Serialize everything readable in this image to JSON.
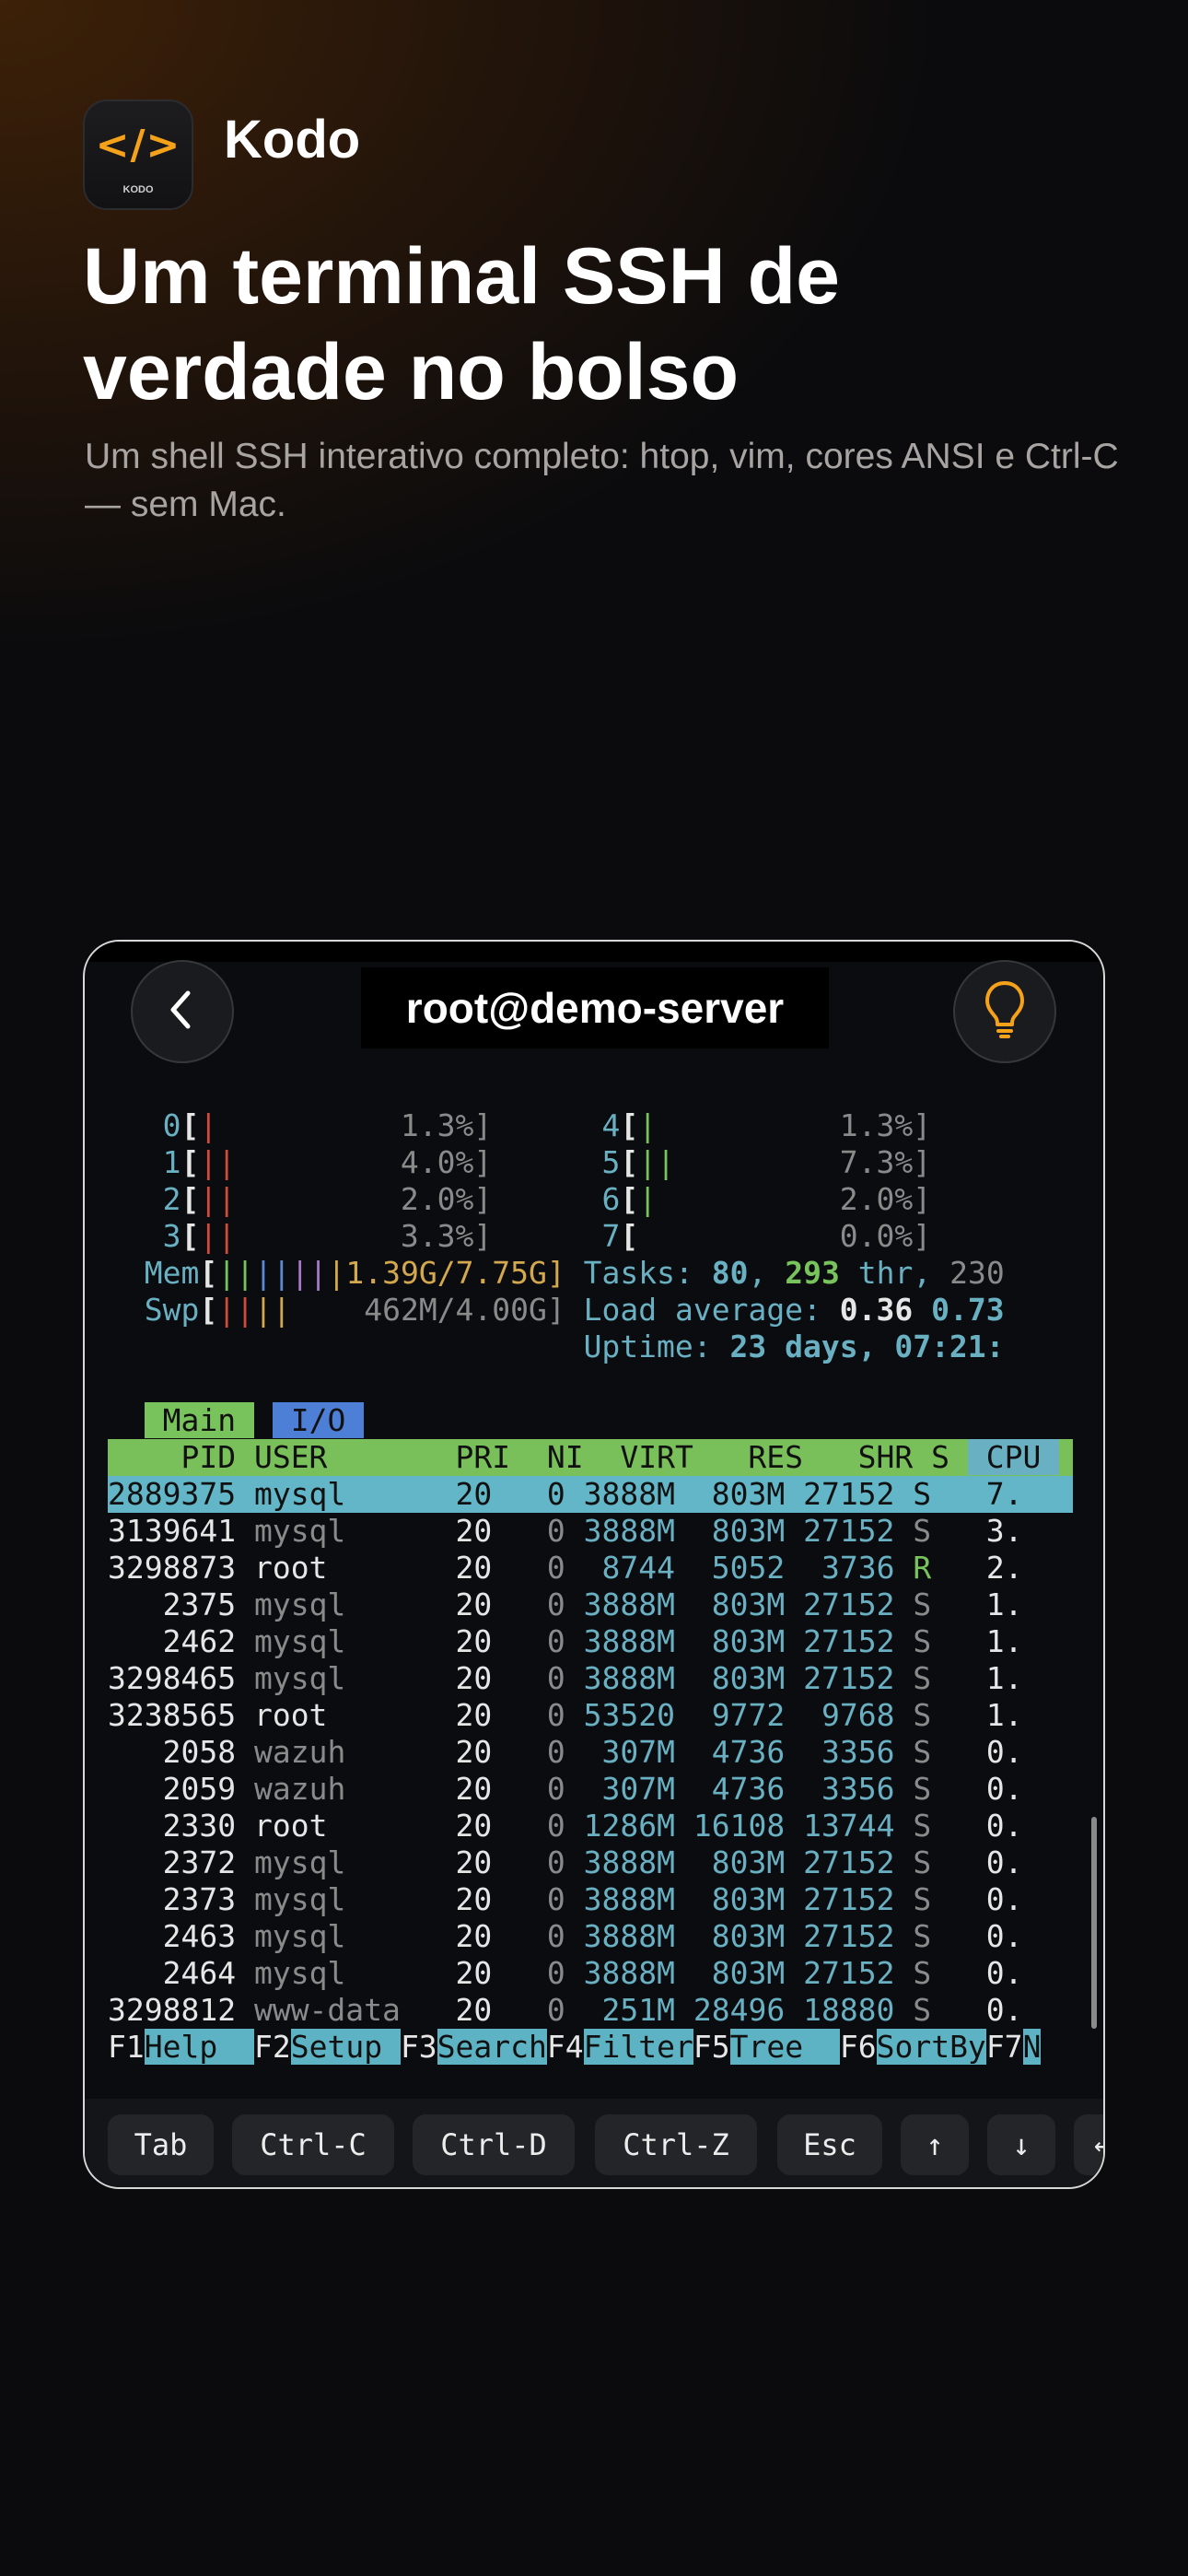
{
  "app": {
    "icon_glyph": "</>",
    "icon_wordmark": "KODO",
    "name": "Kodo"
  },
  "headline": "Um terminal SSH de verdade no bolso",
  "subtitle": "Um shell SSH interativo completo: htop, vim, cores ANSI e Ctrl-C — sem Mac.",
  "session": {
    "title": "root@demo-server",
    "back_icon": "chevron-left-icon",
    "hint_icon": "lightbulb-icon"
  },
  "htop": {
    "cpus": [
      {
        "id": "0",
        "bars": "|",
        "pct": "1.3%]"
      },
      {
        "id": "1",
        "bars": "||",
        "pct": "4.0%]"
      },
      {
        "id": "2",
        "bars": "||",
        "pct": "2.0%]"
      },
      {
        "id": "3",
        "bars": "||",
        "pct": "3.3%]"
      },
      {
        "id": "4",
        "bars": "|",
        "pct": "1.3%]"
      },
      {
        "id": "5",
        "bars": "||",
        "pct": "7.3%]"
      },
      {
        "id": "6",
        "bars": "|",
        "pct": "2.0%]"
      },
      {
        "id": "7",
        "bars": "",
        "pct": "0.0%]"
      }
    ],
    "mem": {
      "label": "Mem",
      "value": "1.39G/7.75G]"
    },
    "swp": {
      "label": "Swp",
      "value": "462M/4.00G]"
    },
    "tasks": {
      "label": "Tasks:",
      "count": "80",
      "sep": ",",
      "thr": "293",
      "thr_label": "thr,",
      "running": "230"
    },
    "load": {
      "label": "Load average:",
      "v1": "0.36",
      "v2": "0.73"
    },
    "uptime": {
      "label": "Uptime:",
      "value": "23 days, 07:21:"
    },
    "tabs": [
      "Main",
      "I/O"
    ],
    "columns": [
      "PID",
      "USER",
      "PRI",
      "NI",
      "VIRT",
      "RES",
      "SHR",
      "S",
      "CPU"
    ],
    "processes": [
      {
        "pid": "2889375",
        "user": "mysql",
        "pri": "20",
        "ni": "0",
        "virt": "3888M",
        "res": "803M",
        "shr": "27152",
        "s": "S",
        "cpu": "7."
      },
      {
        "pid": "3139641",
        "user": "mysql",
        "pri": "20",
        "ni": "0",
        "virt": "3888M",
        "res": "803M",
        "shr": "27152",
        "s": "S",
        "cpu": "3."
      },
      {
        "pid": "3298873",
        "user": "root",
        "pri": "20",
        "ni": "0",
        "virt": "8744",
        "res": "5052",
        "shr": "3736",
        "s": "R",
        "cpu": "2."
      },
      {
        "pid": "2375",
        "user": "mysql",
        "pri": "20",
        "ni": "0",
        "virt": "3888M",
        "res": "803M",
        "shr": "27152",
        "s": "S",
        "cpu": "1."
      },
      {
        "pid": "2462",
        "user": "mysql",
        "pri": "20",
        "ni": "0",
        "virt": "3888M",
        "res": "803M",
        "shr": "27152",
        "s": "S",
        "cpu": "1."
      },
      {
        "pid": "3298465",
        "user": "mysql",
        "pri": "20",
        "ni": "0",
        "virt": "3888M",
        "res": "803M",
        "shr": "27152",
        "s": "S",
        "cpu": "1."
      },
      {
        "pid": "3238565",
        "user": "root",
        "pri": "20",
        "ni": "0",
        "virt": "53520",
        "res": "9772",
        "shr": "9768",
        "s": "S",
        "cpu": "1."
      },
      {
        "pid": "2058",
        "user": "wazuh",
        "pri": "20",
        "ni": "0",
        "virt": "307M",
        "res": "4736",
        "shr": "3356",
        "s": "S",
        "cpu": "0."
      },
      {
        "pid": "2059",
        "user": "wazuh",
        "pri": "20",
        "ni": "0",
        "virt": "307M",
        "res": "4736",
        "shr": "3356",
        "s": "S",
        "cpu": "0."
      },
      {
        "pid": "2330",
        "user": "root",
        "pri": "20",
        "ni": "0",
        "virt": "1286M",
        "res": "16108",
        "shr": "13744",
        "s": "S",
        "cpu": "0."
      },
      {
        "pid": "2372",
        "user": "mysql",
        "pri": "20",
        "ni": "0",
        "virt": "3888M",
        "res": "803M",
        "shr": "27152",
        "s": "S",
        "cpu": "0."
      },
      {
        "pid": "2373",
        "user": "mysql",
        "pri": "20",
        "ni": "0",
        "virt": "3888M",
        "res": "803M",
        "shr": "27152",
        "s": "S",
        "cpu": "0."
      },
      {
        "pid": "2463",
        "user": "mysql",
        "pri": "20",
        "ni": "0",
        "virt": "3888M",
        "res": "803M",
        "shr": "27152",
        "s": "S",
        "cpu": "0."
      },
      {
        "pid": "2464",
        "user": "mysql",
        "pri": "20",
        "ni": "0",
        "virt": "3888M",
        "res": "803M",
        "shr": "27152",
        "s": "S",
        "cpu": "0."
      },
      {
        "pid": "3298812",
        "user": "www-data",
        "pri": "20",
        "ni": "0",
        "virt": "251M",
        "res": "28496",
        "shr": "18880",
        "s": "S",
        "cpu": "0."
      }
    ],
    "fkeys": [
      {
        "key": "F1",
        "label": "Help  "
      },
      {
        "key": "F2",
        "label": "Setup "
      },
      {
        "key": "F3",
        "label": "Search"
      },
      {
        "key": "F4",
        "label": "Filter"
      },
      {
        "key": "F5",
        "label": "Tree  "
      },
      {
        "key": "F6",
        "label": "SortBy"
      },
      {
        "key": "F7",
        "label": "N"
      }
    ]
  },
  "keybar": [
    "Tab",
    "Ctrl-C",
    "Ctrl-D",
    "Ctrl-Z",
    "Esc",
    "↑",
    "↓",
    "←"
  ],
  "colors": {
    "accent": "#f5a21b",
    "cyan": "#6ab0c3",
    "green": "#78c35b",
    "red": "#d14a3c"
  }
}
